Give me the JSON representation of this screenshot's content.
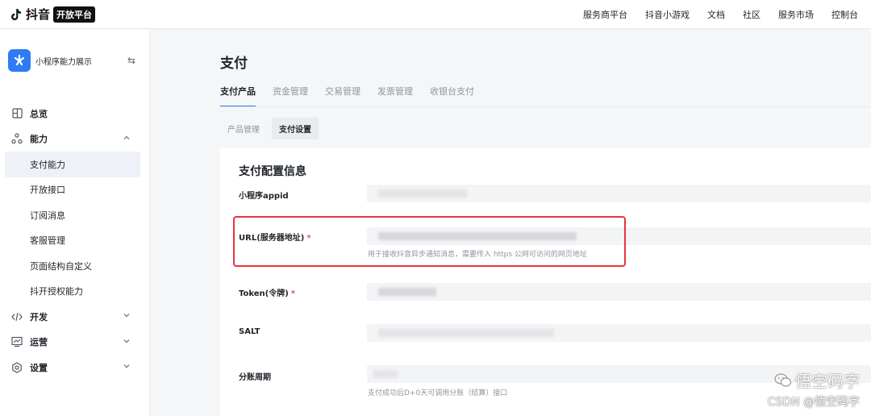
{
  "topbar": {
    "logo_text": "抖音",
    "logo_badge": "开放平台",
    "nav": [
      "服务商平台",
      "抖音小游戏",
      "文档",
      "社区",
      "服务市场",
      "控制台"
    ]
  },
  "sidebar": {
    "app_name": "小程序能力展示",
    "items": [
      {
        "label": "总览",
        "type": "group",
        "icon": "dashboard-icon"
      },
      {
        "label": "能力",
        "type": "group",
        "icon": "capability-icon",
        "expanded": true
      },
      {
        "label": "支付能力",
        "type": "sub",
        "active": true
      },
      {
        "label": "开放接口",
        "type": "sub"
      },
      {
        "label": "订阅消息",
        "type": "sub"
      },
      {
        "label": "客服管理",
        "type": "sub"
      },
      {
        "label": "页面结构自定义",
        "type": "sub"
      },
      {
        "label": "抖开授权能力",
        "type": "sub"
      },
      {
        "label": "开发",
        "type": "group",
        "icon": "code-icon"
      },
      {
        "label": "运营",
        "type": "group",
        "icon": "chart-icon"
      },
      {
        "label": "设置",
        "type": "group",
        "icon": "settings-icon"
      }
    ]
  },
  "main": {
    "title": "支付",
    "tabs": [
      "支付产品",
      "资金管理",
      "交易管理",
      "发票管理",
      "收银台支付"
    ],
    "active_tab": 0,
    "subtabs": [
      "产品管理",
      "支付设置"
    ],
    "active_subtab": 1,
    "panel_title": "支付配置信息",
    "fields": [
      {
        "label": "小程序appid",
        "required": false,
        "hint": ""
      },
      {
        "label": "URL(服务器地址)",
        "required": true,
        "hint": "用于接收抖音异步通知消息，需要传入 https 公网可访问的网页地址"
      },
      {
        "label": "Token(令牌)",
        "required": true,
        "hint": ""
      },
      {
        "label": "SALT",
        "required": false,
        "hint": ""
      },
      {
        "label": "分账周期",
        "required": false,
        "hint": "支付成功后D+0天可调用分账（结算）接口"
      }
    ],
    "required_mark": "*"
  },
  "watermark": {
    "line1": "悟空码字",
    "line2": "CSDN @悟空码字"
  },
  "colors": {
    "accent": "#2f7bf5",
    "highlight": "#e8343c",
    "required": "#f54a45"
  }
}
